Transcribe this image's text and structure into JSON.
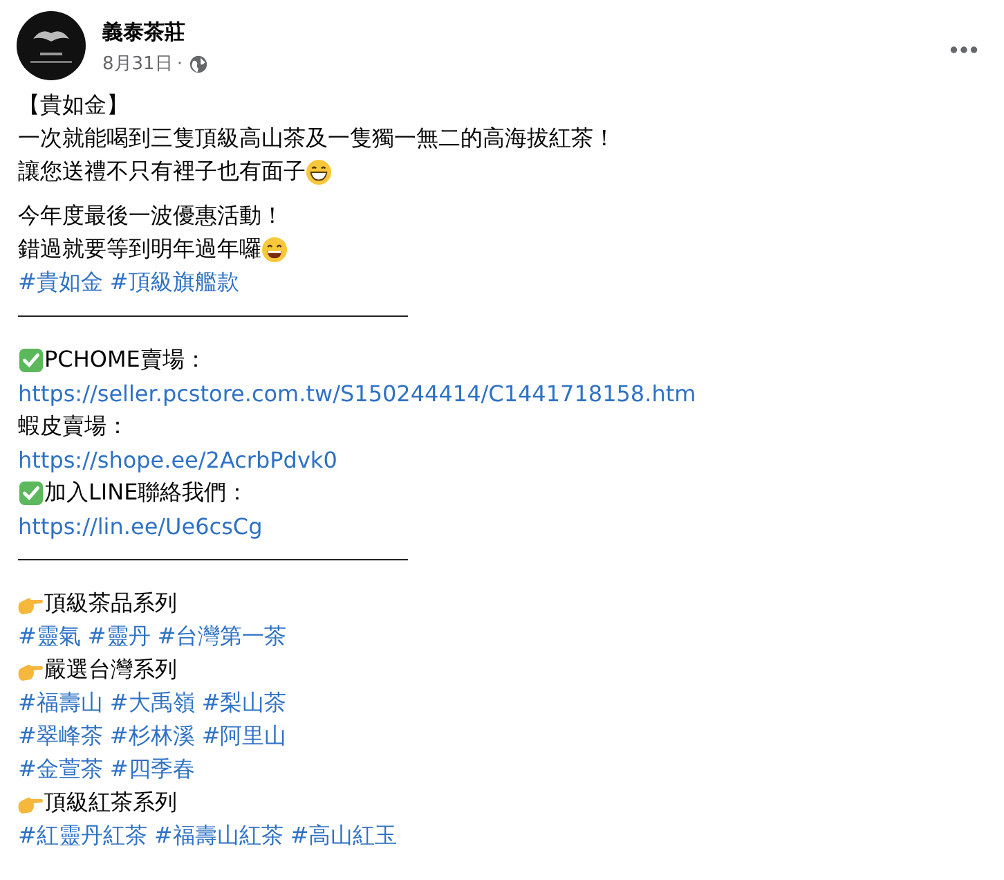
{
  "header": {
    "page_name": "義泰茶莊",
    "date": "8月31日",
    "separator": "·"
  },
  "lines": [
    {
      "kind": "plain",
      "text": "【貴如金】"
    },
    {
      "kind": "plain",
      "text": "一次就能喝到三隻頂級高山茶及一隻獨一無二的高海拔紅茶！"
    },
    {
      "kind": "plain-grin",
      "text": "讓您送禮不只有裡子也有面子"
    },
    {
      "kind": "plain",
      "text": "今年度最後一波優惠活動！",
      "gap_before": true
    },
    {
      "kind": "plain-smile",
      "text": "錯過就要等到明年過年囉"
    },
    {
      "kind": "hashtags",
      "tags": [
        "#貴如金",
        "#頂級旗艦款"
      ]
    },
    {
      "kind": "rule"
    },
    {
      "kind": "checked",
      "text": "PCHOME賣場：",
      "gap_before": true
    },
    {
      "kind": "link",
      "text": "https://seller.pcstore.com.tw/S150244414/C1441718158.htm"
    },
    {
      "kind": "plain",
      "text": "蝦皮賣場："
    },
    {
      "kind": "link",
      "text": "https://shope.ee/2AcrbPdvk0"
    },
    {
      "kind": "checked",
      "text": "加入LINE聯絡我們："
    },
    {
      "kind": "link",
      "text": "https://lin.ee/Ue6csCg"
    },
    {
      "kind": "rule"
    },
    {
      "kind": "pointed",
      "text": "頂級茶品系列",
      "gap_before": true
    },
    {
      "kind": "hashtags",
      "tags": [
        "#靈氣",
        "#靈丹",
        "#台灣第一茶"
      ]
    },
    {
      "kind": "pointed",
      "text": "嚴選台灣系列"
    },
    {
      "kind": "hashtags",
      "tags": [
        "#福壽山",
        "#大禹嶺",
        "#梨山茶"
      ]
    },
    {
      "kind": "hashtags",
      "tags": [
        "#翠峰茶",
        "#杉林溪",
        "#阿里山"
      ]
    },
    {
      "kind": "hashtags",
      "tags": [
        "#金萱茶",
        "#四季春"
      ]
    },
    {
      "kind": "pointed",
      "text": "頂級紅茶系列"
    },
    {
      "kind": "hashtags",
      "tags": [
        "#紅靈丹紅茶",
        "#福壽山紅茶",
        "#高山紅玉"
      ]
    }
  ]
}
